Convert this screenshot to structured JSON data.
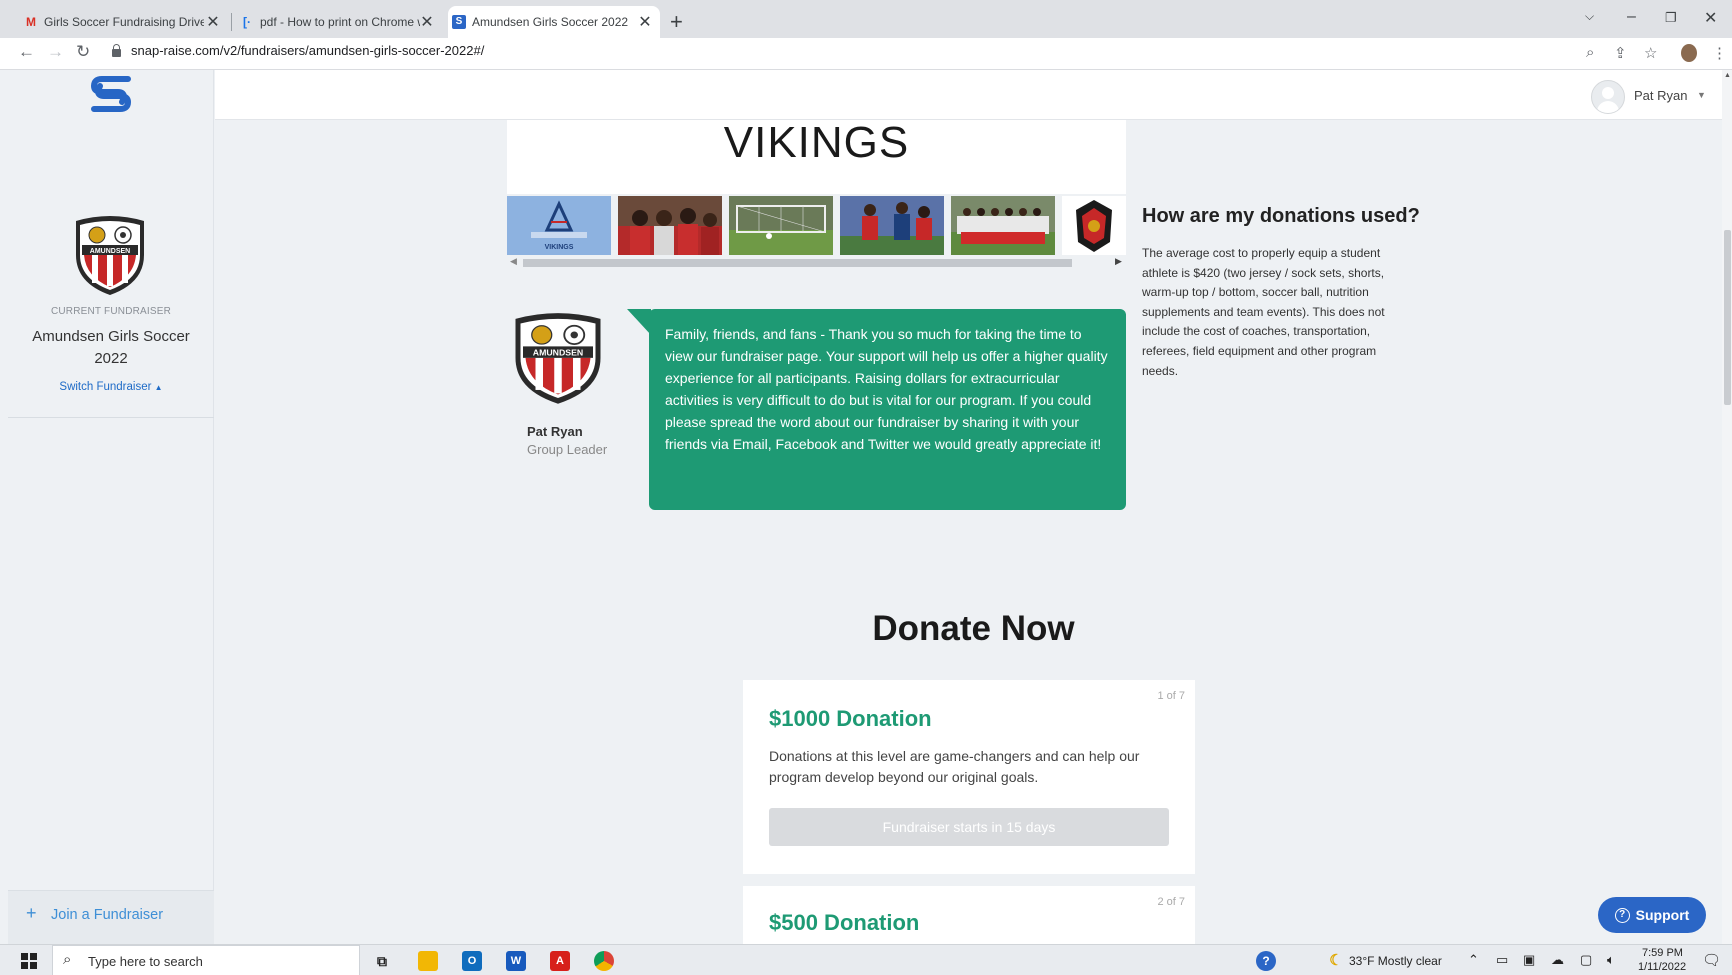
{
  "browser": {
    "tabs": [
      {
        "title": "Girls Soccer Fundraising Drive - p",
        "favicon": "gmail-icon"
      },
      {
        "title": "pdf - How to print on Chrome w",
        "favicon": "document-icon"
      },
      {
        "title": "Amundsen Girls Soccer 2022",
        "favicon": "snap-raise-icon",
        "active": true
      }
    ],
    "url": "snap-raise.com/v2/fundraisers/amundsen-girls-soccer-2022#/"
  },
  "sidebar": {
    "current_label": "CURRENT FUNDRAISER",
    "fundraiser_name": "Amundsen Girls Soccer 2022",
    "switch_label": "Switch Fundraiser",
    "join_label": "Join a Fundraiser"
  },
  "header": {
    "user_name": "Pat Ryan"
  },
  "hero": {
    "title": "VIKINGS",
    "thumb_label": "VIKINGS"
  },
  "crest_text": "AMUNDSEN",
  "leader": {
    "name": "Pat Ryan",
    "role": "Group Leader",
    "message": "Family, friends, and fans - Thank you so much for taking the time to view our fundraiser page. Your support will help us offer a higher quality experience for all participants. Raising dollars for extracurricular activities is very difficult to do but is vital for our program. If you could please spread the word about our fundraiser by sharing it with your friends via Email, Facebook and Twitter we would greatly appreciate it!"
  },
  "donations_used": {
    "heading": "How are my donations used?",
    "text": "The average cost to properly equip a student athlete is $420 (two jersey / sock sets, shorts, warm-up top / bottom, soccer ball, nutrition supplements and team events). This does not include the cost of coaches, transportation, referees, field equipment and other program needs."
  },
  "donate": {
    "heading": "Donate Now",
    "cards": [
      {
        "count": "1 of 7",
        "title": "$1000 Donation",
        "description": "Donations at this level are game-changers and can help our program develop beyond our original goals.",
        "button": "Fundraiser starts in 15 days"
      },
      {
        "count": "2 of 7",
        "title": "$500 Donation"
      }
    ]
  },
  "support_label": "Support",
  "taskbar": {
    "search_placeholder": "Type here to search",
    "weather": "33°F  Mostly clear",
    "time": "7:59 PM",
    "date": "1/11/2022"
  },
  "colors": {
    "accent_green": "#1e9a74",
    "link_blue": "#1e6bc7",
    "support_blue": "#2b66c6"
  }
}
